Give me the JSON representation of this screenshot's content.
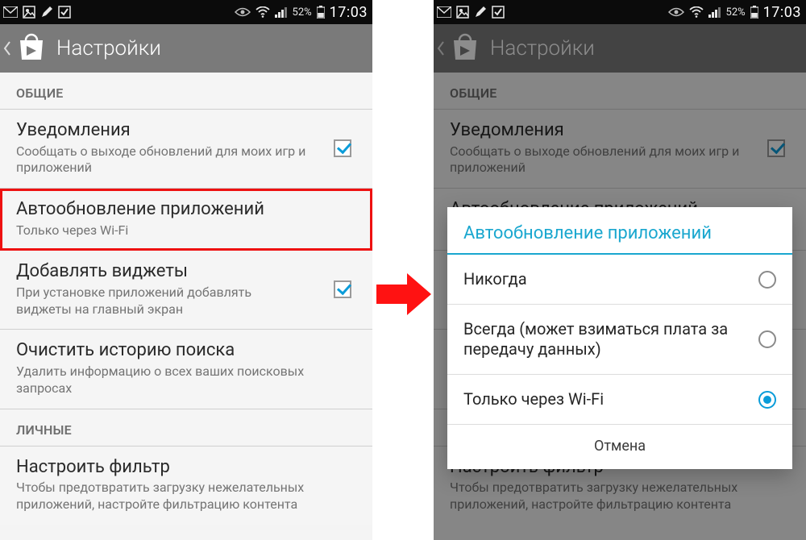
{
  "status": {
    "time": "17:03",
    "battery_pct": "52%"
  },
  "actionbar": {
    "title": "Настройки"
  },
  "sections": {
    "general": "ОБЩИЕ",
    "personal": "ЛИЧНЫЕ"
  },
  "rows": {
    "notifications": {
      "title": "Уведомления",
      "sub": "Сообщать о выходе обновлений для моих игр и приложений"
    },
    "auto_update": {
      "title": "Автообновление приложений",
      "sub": "Только через Wi-Fi"
    },
    "widgets": {
      "title": "Добавлять виджеты",
      "sub": "При установке приложений добавлять виджеты на главный экран"
    },
    "clear_search": {
      "title": "Очистить историю поиска",
      "sub": "Удалить информацию о всех ваших поисковых запросах"
    },
    "filter": {
      "title": "Настроить фильтр",
      "sub": "Чтобы предотвратить загрузку нежелательных приложений, настройте фильтрацию контента"
    }
  },
  "dialog": {
    "title": "Автообновление приложений",
    "options": {
      "never": "Никогда",
      "always": "Всегда (может взиматься плата за передачу данных)",
      "wifi": "Только через Wi-Fi"
    },
    "cancel": "Отмена"
  },
  "colors": {
    "accent_blue": "#1aa7cf",
    "check_blue": "#0a9cd9",
    "highlight_red": "#e11"
  }
}
